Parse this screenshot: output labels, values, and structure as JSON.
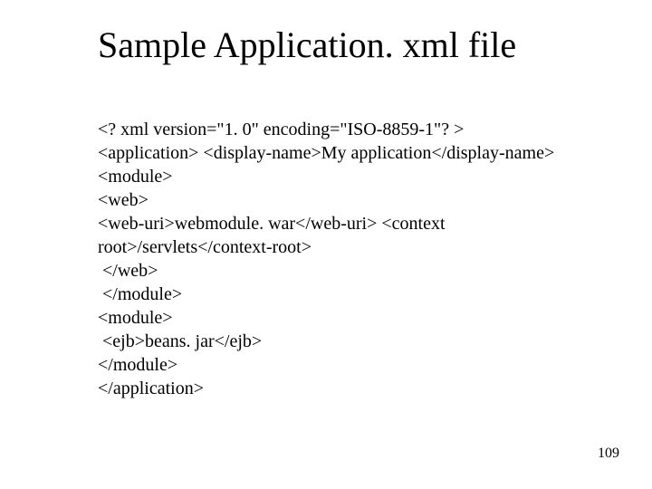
{
  "title": "Sample Application. xml file",
  "lines": [
    "<? xml version=\"1. 0\" encoding=\"ISO-8859-1\"? >",
    "<application> <display-name>My application</display-name>",
    "<module>",
    "<web>",
    "<web-uri>webmodule. war</web-uri> <context",
    "root>/servlets</context-root>",
    " </web>",
    " </module>",
    "<module>",
    " <ejb>beans. jar</ejb>",
    "</module>",
    "</application>"
  ],
  "page_number": "109"
}
